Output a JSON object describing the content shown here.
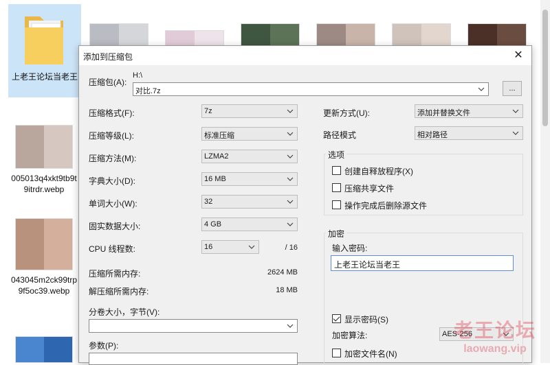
{
  "explorer": {
    "folder": {
      "label": "上老王论坛当老王"
    },
    "files": [
      {
        "label": "005013q4xkt9tb9t9itrdr.webp"
      },
      {
        "label": "043045m2ck99trp9f5oc39.webp"
      }
    ]
  },
  "dialog": {
    "title": "添加到压缩包",
    "archive_label": "压缩包(A):",
    "archive_path": "H:\\",
    "archive_name": "对比.7z",
    "browse_label": "...",
    "format_label": "压缩格式(F):",
    "format_value": "7z",
    "level_label": "压缩等级(L):",
    "level_value": "标准压缩",
    "method_label": "压缩方法(M):",
    "method_value": "LZMA2",
    "dict_label": "字典大小(D):",
    "dict_value": "16 MB",
    "word_label": "单词大小(W):",
    "word_value": "32",
    "solid_label": "固实数据大小:",
    "solid_value": "4 GB",
    "cpu_label": "CPU 线程数:",
    "cpu_value": "16",
    "cpu_total": "/ 16",
    "mem_comp_label": "压缩所需内存:",
    "mem_comp_value": "2624 MB",
    "mem_decomp_label": "解压缩所需内存:",
    "mem_decomp_value": "18 MB",
    "split_label": "分卷大小，字节(V):",
    "split_value": "",
    "params_label": "参数(P):",
    "params_value": "",
    "update_label": "更新方式(U):",
    "update_value": "添加并替换文件",
    "path_label": "路径模式",
    "path_value": "相对路径",
    "options": {
      "title": "选项",
      "sfx": "创建自释放程序(X)",
      "shared": "压缩共享文件",
      "delete": "操作完成后删除源文件"
    },
    "encryption": {
      "title": "加密",
      "password_label": "输入密码:",
      "password_value": "上老王论坛当老王",
      "show_password": "显示密码(S)",
      "method_label": "加密算法:",
      "method_value": "AES-256",
      "encrypt_names": "加密文件名(N)"
    }
  },
  "watermark": {
    "line1": "老王论坛",
    "line2": "laowang.vip"
  }
}
